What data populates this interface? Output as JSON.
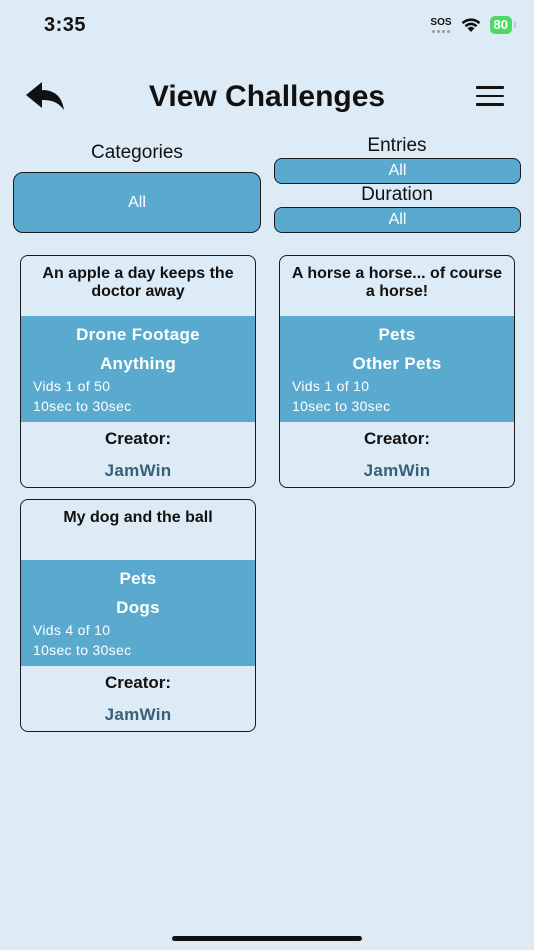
{
  "status_bar": {
    "time": "3:35",
    "sos": "SOS",
    "battery": "80"
  },
  "header": {
    "title": "View Challenges",
    "back_icon": "back-arrow-icon",
    "menu_icon": "hamburger-menu-icon"
  },
  "filters": {
    "categories": {
      "label": "Categories",
      "value": "All"
    },
    "entries": {
      "label": "Entries",
      "value": "All"
    },
    "duration": {
      "label": "Duration",
      "value": "All"
    }
  },
  "challenges": [
    {
      "title": "An apple a day keeps the doctor away",
      "category": "Drone Footage",
      "subcategory": "Anything",
      "vids": "Vids 1 of 50",
      "duration": "10sec to 30sec",
      "creator_label": "Creator:",
      "creator": "JamWin"
    },
    {
      "title": "A horse a horse... of course a horse!",
      "category": "Pets",
      "subcategory": "Other Pets",
      "vids": "Vids 1 of 10",
      "duration": "10sec to 30sec",
      "creator_label": "Creator:",
      "creator": "JamWin"
    },
    {
      "title": "My dog and the ball",
      "category": "Pets",
      "subcategory": "Dogs",
      "vids": "Vids 4 of 10",
      "duration": "10sec to 30sec",
      "creator_label": "Creator:",
      "creator": "JamWin"
    }
  ],
  "colors": {
    "background": "#dcebf5",
    "accent": "#5aaacf",
    "creator_text": "#3b5f78",
    "battery": "#4cd964"
  }
}
